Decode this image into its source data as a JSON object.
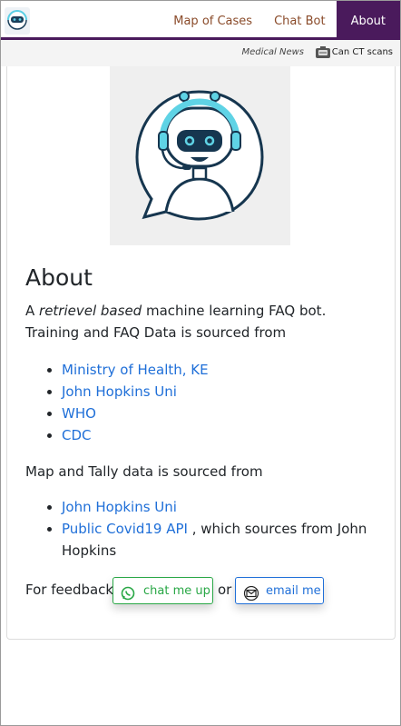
{
  "nav": {
    "logo_icon": "robot-logo-icon",
    "links": [
      {
        "label": "Map of Cases"
      },
      {
        "label": "Chat Bot"
      },
      {
        "label": "About"
      }
    ],
    "active_color": "#4a1a5c"
  },
  "subnav": {
    "news_label": "Medical News",
    "ct_label": "Can CT scans",
    "ct_icon": "scanner-icon"
  },
  "about": {
    "image_icon": "chatbot-avatar-icon",
    "title": "About",
    "intro_prefix": "A ",
    "intro_em": "retrievel based",
    "intro_suffix": " machine learning FAQ bot.",
    "training_line": "Training and FAQ Data is sourced from",
    "training_sources": [
      "Ministry of Health, KE",
      "John Hopkins Uni",
      "WHO",
      "CDC"
    ],
    "map_line": "Map and Tally data is sourced from",
    "map_sources": [
      {
        "link": "John Hopkins Uni",
        "suffix": ""
      },
      {
        "link": "Public Covid19 API",
        "suffix": " , which sources from John"
      },
      {
        "link": "",
        "suffix": "Hopkins"
      }
    ],
    "feedback_label": "For feedback",
    "or_label": "or",
    "chat_button": "chat me up",
    "email_button": "email me",
    "link_color": "#1f6fd8",
    "chat_color": "#28a745"
  }
}
